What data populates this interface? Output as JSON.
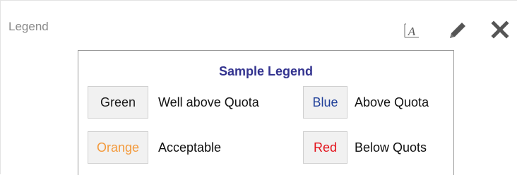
{
  "panel": {
    "title": "Legend"
  },
  "toolbar": {
    "font_icon_glyph": "A"
  },
  "legend": {
    "title": "Sample Legend",
    "items": [
      {
        "label": "Green",
        "description": "Well above Quota",
        "label_color": "#1a1a1a"
      },
      {
        "label": "Blue",
        "description": "Above Quota",
        "label_color": "#1f3f99"
      },
      {
        "label": "Orange",
        "description": "Acceptable",
        "label_color": "#f39a3c"
      },
      {
        "label": "Red",
        "description": "Below Quots",
        "label_color": "#e3121b"
      }
    ]
  },
  "colors": {
    "legend_title": "#33338f",
    "icon": "#555555"
  }
}
